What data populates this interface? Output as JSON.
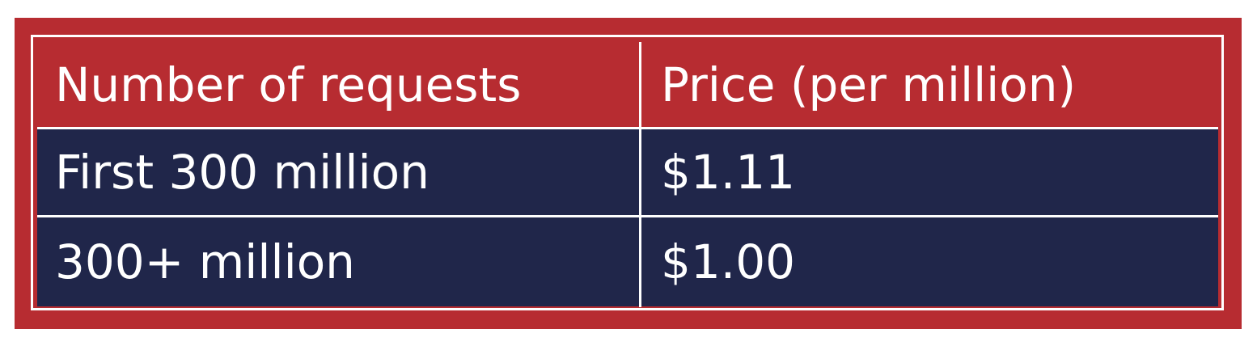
{
  "table": {
    "headers": [
      "Number of requests",
      "Price (per million)"
    ],
    "rows": [
      [
        "First 300 million",
        "$1.11"
      ],
      [
        "300+ million",
        "$1.00"
      ]
    ]
  },
  "colors": {
    "frame_red": "#b72c31",
    "row_navy": "#20264a",
    "text_white": "#ffffff"
  }
}
